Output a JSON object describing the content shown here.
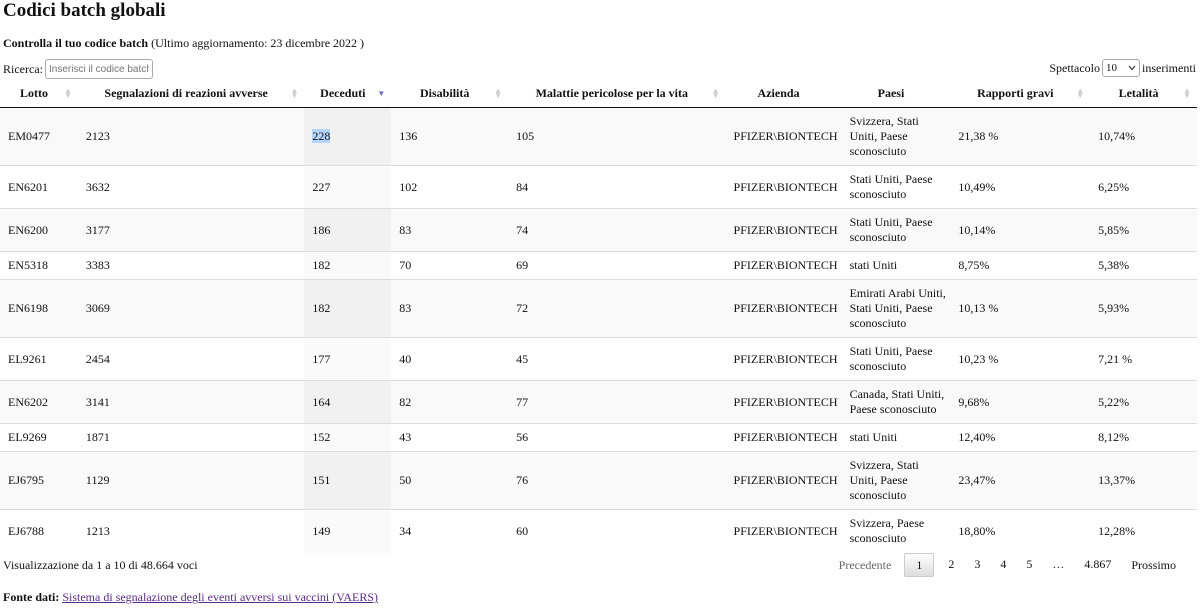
{
  "title": "Codici batch globali",
  "subtitle": {
    "bold": "Controlla il tuo codice batch",
    "rest": "(Ultimo aggiornamento: 23 dicembre 2022 )"
  },
  "search": {
    "label": "Ricerca:",
    "placeholder": "Inserisci il codice batch"
  },
  "length": {
    "prefix": "Spettacolo",
    "value": "10",
    "suffix": "inserimenti"
  },
  "columns": [
    "Lotto",
    "Segnalazioni di reazioni avverse",
    "Deceduti",
    "Disabilità",
    "Malattie pericolose per la vita",
    "Azienda",
    "Paesi",
    "Rapporti gravi",
    "Letalità"
  ],
  "rows": [
    {
      "lotto": "EM0477",
      "segnalazioni": "2123",
      "deceduti": "228",
      "disabilita": "136",
      "malattie": "105",
      "azienda": "PFIZER\\BIONTECH",
      "paesi": "Svizzera, Stati Uniti, Paese sconosciuto",
      "gravi": "21,38 %",
      "letalita": "10,74%"
    },
    {
      "lotto": "EN6201",
      "segnalazioni": "3632",
      "deceduti": "227",
      "disabilita": "102",
      "malattie": "84",
      "azienda": "PFIZER\\BIONTECH",
      "paesi": "Stati Uniti, Paese sconosciuto",
      "gravi": "10,49%",
      "letalita": "6,25%"
    },
    {
      "lotto": "EN6200",
      "segnalazioni": "3177",
      "deceduti": "186",
      "disabilita": "83",
      "malattie": "74",
      "azienda": "PFIZER\\BIONTECH",
      "paesi": "Stati Uniti, Paese sconosciuto",
      "gravi": "10,14%",
      "letalita": "5,85%"
    },
    {
      "lotto": "EN5318",
      "segnalazioni": "3383",
      "deceduti": "182",
      "disabilita": "70",
      "malattie": "69",
      "azienda": "PFIZER\\BIONTECH",
      "paesi": "stati Uniti",
      "gravi": "8,75%",
      "letalita": "5,38%"
    },
    {
      "lotto": "EN6198",
      "segnalazioni": "3069",
      "deceduti": "182",
      "disabilita": "83",
      "malattie": "72",
      "azienda": "PFIZER\\BIONTECH",
      "paesi": "Emirati Arabi Uniti, Stati Uniti, Paese sconosciuto",
      "gravi": "10,13 %",
      "letalita": "5,93%"
    },
    {
      "lotto": "EL9261",
      "segnalazioni": "2454",
      "deceduti": "177",
      "disabilita": "40",
      "malattie": "45",
      "azienda": "PFIZER\\BIONTECH",
      "paesi": "Stati Uniti, Paese sconosciuto",
      "gravi": "10,23 %",
      "letalita": "7,21 %"
    },
    {
      "lotto": "EN6202",
      "segnalazioni": "3141",
      "deceduti": "164",
      "disabilita": "82",
      "malattie": "77",
      "azienda": "PFIZER\\BIONTECH",
      "paesi": "Canada, Stati Uniti, Paese sconosciuto",
      "gravi": "9,68%",
      "letalita": "5,22%"
    },
    {
      "lotto": "EL9269",
      "segnalazioni": "1871",
      "deceduti": "152",
      "disabilita": "43",
      "malattie": "56",
      "azienda": "PFIZER\\BIONTECH",
      "paesi": "stati Uniti",
      "gravi": "12,40%",
      "letalita": "8,12%"
    },
    {
      "lotto": "EJ6795",
      "segnalazioni": "1129",
      "deceduti": "151",
      "disabilita": "50",
      "malattie": "76",
      "azienda": "PFIZER\\BIONTECH",
      "paesi": "Svizzera, Stati Uniti, Paese sconosciuto",
      "gravi": "23,47%",
      "letalita": "13,37%"
    },
    {
      "lotto": "EJ6788",
      "segnalazioni": "1213",
      "deceduti": "149",
      "disabilita": "34",
      "malattie": "60",
      "azienda": "PFIZER\\BIONTECH",
      "paesi": "Svizzera, Paese sconosciuto",
      "gravi": "18,80%",
      "letalita": "12,28%"
    }
  ],
  "info": "Visualizzazione da 1 a 10 di 48.664 voci",
  "pagination": {
    "prev": "Precedente",
    "pages": [
      "1",
      "2",
      "3",
      "4",
      "5",
      "…",
      "4.867"
    ],
    "current": "1",
    "next": "Prossimo"
  },
  "source": {
    "label": "Fonte dati:",
    "link": "Sistema di segnalazione degli eventi avversi sui vaccini (VAERS)"
  },
  "colors": {
    "sort_active": "#6b6bd4",
    "highlight": "#b4d5fe",
    "link": "#5a2a8a"
  }
}
